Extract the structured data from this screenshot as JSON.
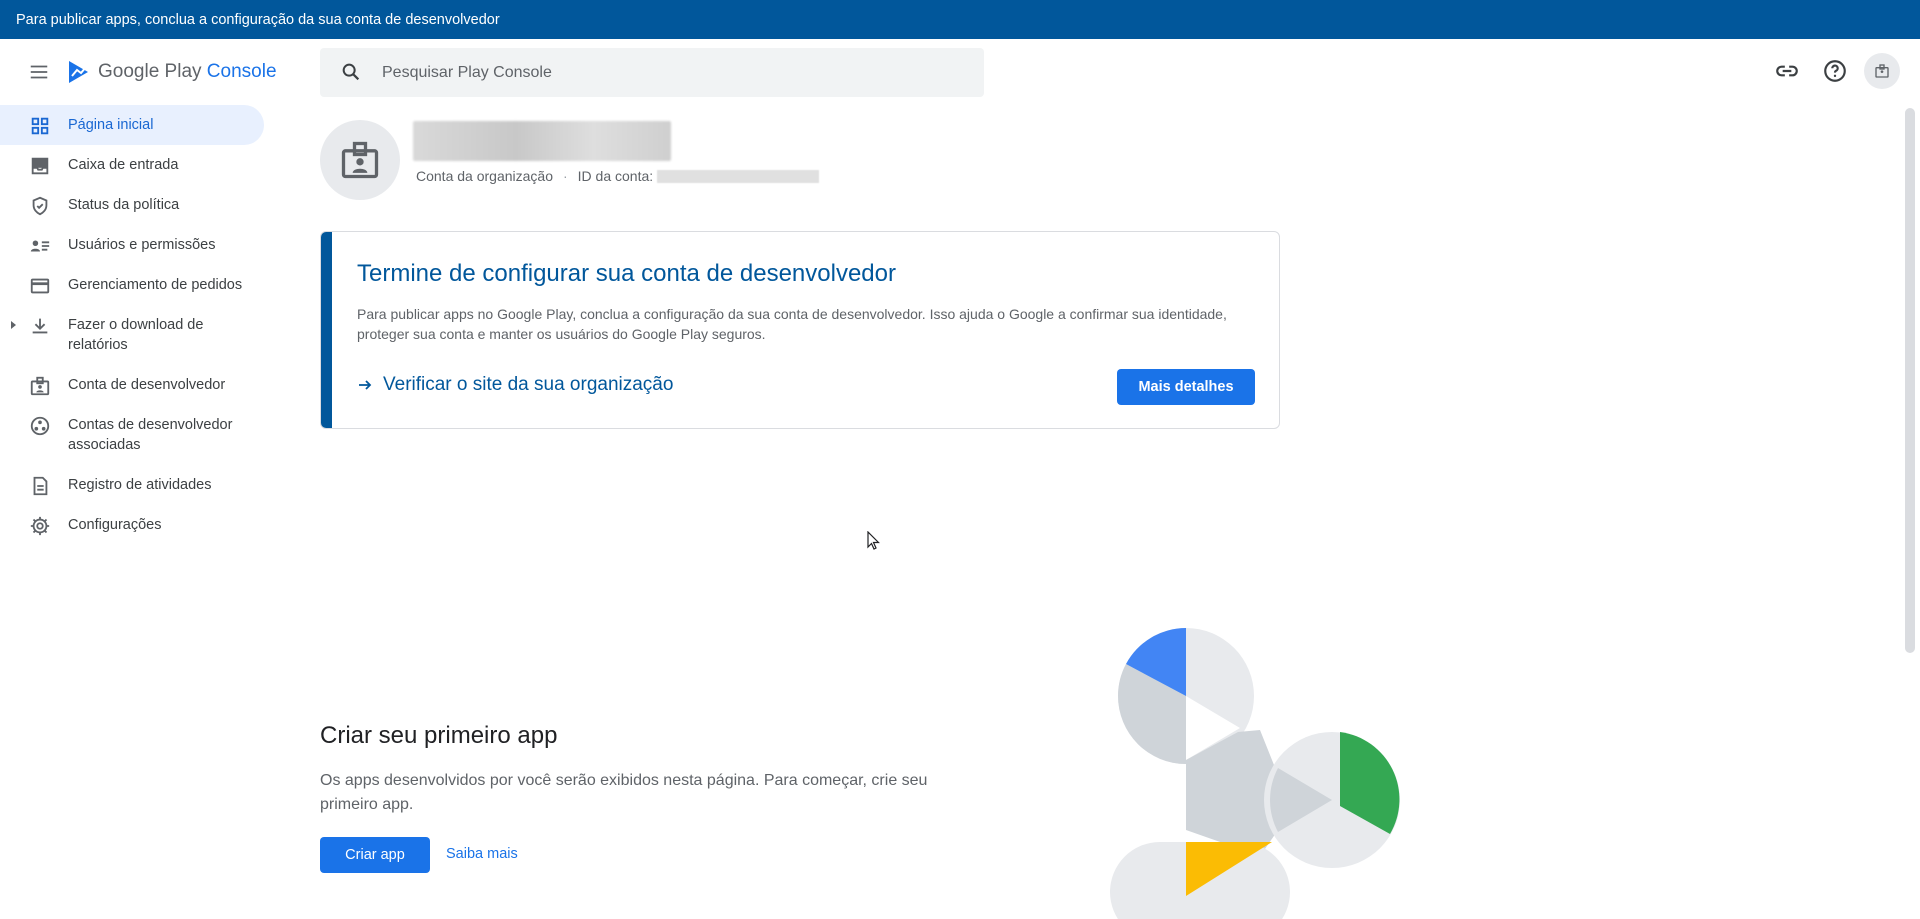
{
  "banner": {
    "text": "Para publicar apps, conclua a configuração da sua conta de desenvolvedor"
  },
  "brand": {
    "google_play": "Google Play",
    "console": "Console"
  },
  "search": {
    "placeholder": "Pesquisar Play Console"
  },
  "sidebar": {
    "items": [
      {
        "label": "Página inicial",
        "icon": "dashboard-icon",
        "active": true
      },
      {
        "label": "Caixa de entrada",
        "icon": "inbox-icon"
      },
      {
        "label": "Status da política",
        "icon": "shield-icon"
      },
      {
        "label": "Usuários e permissões",
        "icon": "users-list-icon"
      },
      {
        "label": "Gerenciamento de pedidos",
        "icon": "credit-card-icon"
      },
      {
        "label": "Fazer o download de relatórios",
        "icon": "download-icon",
        "expandable": true
      },
      {
        "label": "Conta de desenvolvedor",
        "icon": "id-badge-icon"
      },
      {
        "label": "Contas de desenvolvedor associadas",
        "icon": "linked-accounts-icon"
      },
      {
        "label": "Registro de atividades",
        "icon": "document-icon"
      },
      {
        "label": "Configurações",
        "icon": "gear-icon"
      }
    ]
  },
  "top_actions": {
    "icons": [
      "link-icon",
      "help-icon",
      "account-badge-icon"
    ]
  },
  "account": {
    "type_label": "Conta da organização",
    "separator": "·",
    "id_label": "ID da conta:"
  },
  "setup_card": {
    "title": "Termine de configurar sua conta de desenvolvedor",
    "description": "Para publicar apps no Google Play, conclua a configuração da sua conta de desenvolvedor. Isso ajuda o Google a confirmar sua identidade, proteger sua conta e manter os usuários do Google Play seguros.",
    "link": "Verificar o site da sua organização",
    "button": "Mais detalhes"
  },
  "create_app": {
    "title": "Criar seu primeiro app",
    "description": "Os apps desenvolvidos por você serão exibidos nesta página. Para começar, crie seu primeiro app.",
    "button": "Criar app",
    "learn_more": "Saiba mais"
  },
  "colors": {
    "banner": "#01579b",
    "accent": "#1a73e8",
    "active_nav_bg": "#e8f0fe",
    "illustration_blue": "#4285f4",
    "illustration_green": "#34a853",
    "illustration_yellow": "#fbbc04"
  }
}
